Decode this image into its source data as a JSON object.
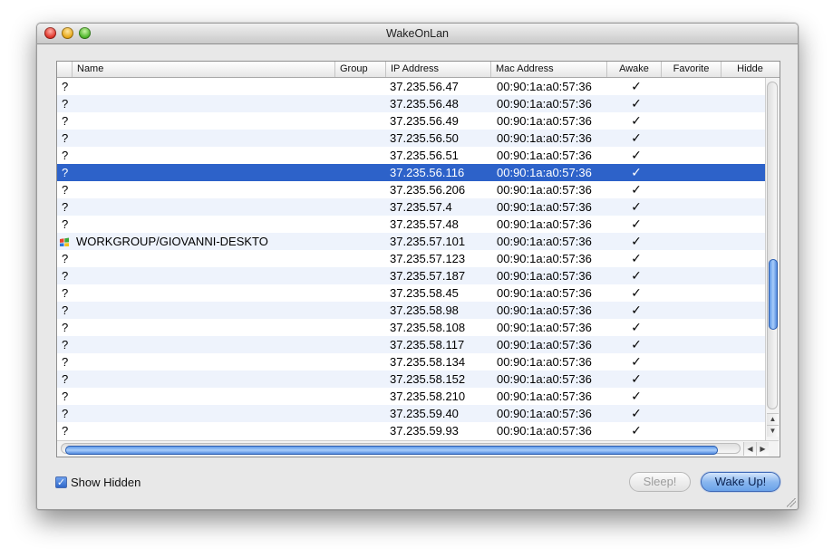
{
  "window": {
    "title": "WakeOnLan"
  },
  "columns": {
    "name": "Name",
    "group": "Group",
    "ip": "IP Address",
    "mac": "Mac Address",
    "awake": "Awake",
    "favorite": "Favorite",
    "hidden": "Hidde"
  },
  "rows": [
    {
      "name": "?",
      "ip": "37.235.56.47",
      "mac": "00:90:1a:a0:57:36",
      "awake": "✓"
    },
    {
      "name": "?",
      "ip": "37.235.56.48",
      "mac": "00:90:1a:a0:57:36",
      "awake": "✓"
    },
    {
      "name": "?",
      "ip": "37.235.56.49",
      "mac": "00:90:1a:a0:57:36",
      "awake": "✓"
    },
    {
      "name": "?",
      "ip": "37.235.56.50",
      "mac": "00:90:1a:a0:57:36",
      "awake": "✓"
    },
    {
      "name": "?",
      "ip": "37.235.56.51",
      "mac": "00:90:1a:a0:57:36",
      "awake": "✓"
    },
    {
      "name": "?",
      "ip": "37.235.56.116",
      "mac": "00:90:1a:a0:57:36",
      "awake": "✓",
      "selected": true
    },
    {
      "name": "?",
      "ip": "37.235.56.206",
      "mac": "00:90:1a:a0:57:36",
      "awake": "✓"
    },
    {
      "name": "?",
      "ip": "37.235.57.4",
      "mac": "00:90:1a:a0:57:36",
      "awake": "✓"
    },
    {
      "name": "?",
      "ip": "37.235.57.48",
      "mac": "00:90:1a:a0:57:36",
      "awake": "✓"
    },
    {
      "name": "WORKGROUP/GIOVANNI-DESKTO",
      "ip": "37.235.57.101",
      "mac": "00:90:1a:a0:57:36",
      "awake": "✓",
      "icon": "windows-icon"
    },
    {
      "name": "?",
      "ip": "37.235.57.123",
      "mac": "00:90:1a:a0:57:36",
      "awake": "✓"
    },
    {
      "name": "?",
      "ip": "37.235.57.187",
      "mac": "00:90:1a:a0:57:36",
      "awake": "✓"
    },
    {
      "name": "?",
      "ip": "37.235.58.45",
      "mac": "00:90:1a:a0:57:36",
      "awake": "✓"
    },
    {
      "name": "?",
      "ip": "37.235.58.98",
      "mac": "00:90:1a:a0:57:36",
      "awake": "✓"
    },
    {
      "name": "?",
      "ip": "37.235.58.108",
      "mac": "00:90:1a:a0:57:36",
      "awake": "✓"
    },
    {
      "name": "?",
      "ip": "37.235.58.117",
      "mac": "00:90:1a:a0:57:36",
      "awake": "✓"
    },
    {
      "name": "?",
      "ip": "37.235.58.134",
      "mac": "00:90:1a:a0:57:36",
      "awake": "✓"
    },
    {
      "name": "?",
      "ip": "37.235.58.152",
      "mac": "00:90:1a:a0:57:36",
      "awake": "✓"
    },
    {
      "name": "?",
      "ip": "37.235.58.210",
      "mac": "00:90:1a:a0:57:36",
      "awake": "✓"
    },
    {
      "name": "?",
      "ip": "37.235.59.40",
      "mac": "00:90:1a:a0:57:36",
      "awake": "✓"
    },
    {
      "name": "?",
      "ip": "37.235.59.93",
      "mac": "00:90:1a:a0:57:36",
      "awake": "✓"
    }
  ],
  "footer": {
    "show_hidden_label": "Show Hidden",
    "show_hidden_checked": true,
    "checkmark": "✓",
    "sleep_label": "Sleep!",
    "wake_label": "Wake Up!"
  },
  "scroll": {
    "up_arrow": "▲",
    "down_arrow": "▼",
    "left_arrow": "◀",
    "right_arrow": "▶"
  },
  "colors": {
    "selection": "#2d62c9",
    "stripe": "#eef3fc",
    "accent": "#6aa2e9"
  }
}
